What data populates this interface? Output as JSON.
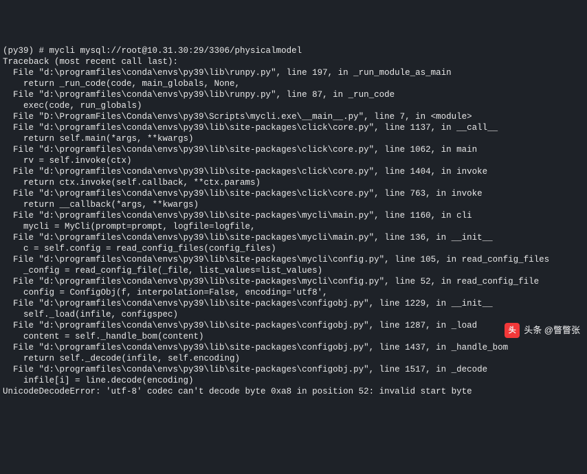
{
  "terminal": {
    "lines": [
      "(py39) # mycli mysql://root@10.31.30:29/3306/physicalmodel",
      "Traceback (most recent call last):",
      "  File \"d:\\programfiles\\conda\\envs\\py39\\lib\\runpy.py\", line 197, in _run_module_as_main",
      "    return _run_code(code, main_globals, None,",
      "  File \"d:\\programfiles\\conda\\envs\\py39\\lib\\runpy.py\", line 87, in _run_code",
      "    exec(code, run_globals)",
      "  File \"D:\\ProgramFiles\\Conda\\envs\\py39\\Scripts\\mycli.exe\\__main__.py\", line 7, in <module>",
      "  File \"d:\\programfiles\\conda\\envs\\py39\\lib\\site-packages\\click\\core.py\", line 1137, in __call__",
      "    return self.main(*args, **kwargs)",
      "  File \"d:\\programfiles\\conda\\envs\\py39\\lib\\site-packages\\click\\core.py\", line 1062, in main",
      "    rv = self.invoke(ctx)",
      "  File \"d:\\programfiles\\conda\\envs\\py39\\lib\\site-packages\\click\\core.py\", line 1404, in invoke",
      "    return ctx.invoke(self.callback, **ctx.params)",
      "  File \"d:\\programfiles\\conda\\envs\\py39\\lib\\site-packages\\click\\core.py\", line 763, in invoke",
      "    return __callback(*args, **kwargs)",
      "  File \"d:\\programfiles\\conda\\envs\\py39\\lib\\site-packages\\mycli\\main.py\", line 1160, in cli",
      "    mycli = MyCli(prompt=prompt, logfile=logfile,",
      "  File \"d:\\programfiles\\conda\\envs\\py39\\lib\\site-packages\\mycli\\main.py\", line 136, in __init__",
      "    c = self.config = read_config_files(config_files)",
      "  File \"d:\\programfiles\\conda\\envs\\py39\\lib\\site-packages\\mycli\\config.py\", line 105, in read_config_files",
      "    _config = read_config_file(_file, list_values=list_values)",
      "  File \"d:\\programfiles\\conda\\envs\\py39\\lib\\site-packages\\mycli\\config.py\", line 52, in read_config_file",
      "    config = ConfigObj(f, interpolation=False, encoding='utf8',",
      "  File \"d:\\programfiles\\conda\\envs\\py39\\lib\\site-packages\\configobj.py\", line 1229, in __init__",
      "    self._load(infile, configspec)",
      "  File \"d:\\programfiles\\conda\\envs\\py39\\lib\\site-packages\\configobj.py\", line 1287, in _load",
      "    content = self._handle_bom(content)",
      "  File \"d:\\programfiles\\conda\\envs\\py39\\lib\\site-packages\\configobj.py\", line 1437, in _handle_bom",
      "    return self._decode(infile, self.encoding)",
      "  File \"d:\\programfiles\\conda\\envs\\py39\\lib\\site-packages\\configobj.py\", line 1517, in _decode",
      "    infile[i] = line.decode(encoding)",
      "UnicodeDecodeError: 'utf-8' codec can't decode byte 0xa8 in position 52: invalid start byte"
    ]
  },
  "watermark": {
    "logo_text": "头",
    "label": "头条 @瞥瞥张"
  }
}
